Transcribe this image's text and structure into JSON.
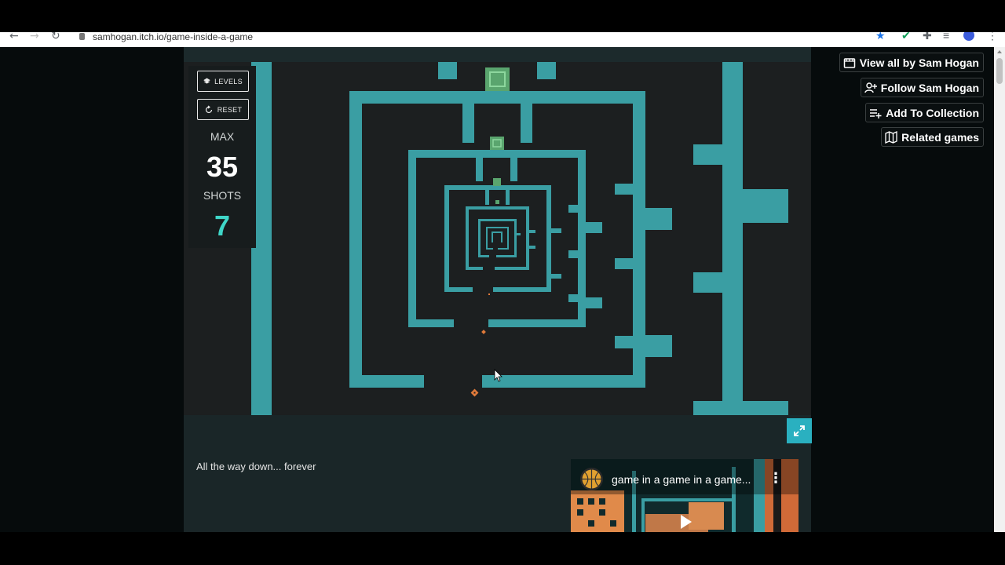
{
  "browser": {
    "url": "samhogan.itch.io/game-inside-a-game"
  },
  "hud": {
    "levels_label": "LEVELS",
    "reset_label": "RESET",
    "max_label": "MAX",
    "max_value": "35",
    "shots_label": "SHOTS",
    "shots_value": "7",
    "shots_color": "#3fd6c8"
  },
  "sidebar": {
    "view_all": "View all by Sam Hogan",
    "follow": "Follow Sam Hogan",
    "add_collection": "Add To Collection",
    "related": "Related games"
  },
  "page": {
    "description": "All the way down... forever"
  },
  "video": {
    "title": "game in a game in a game..."
  },
  "colors": {
    "wall": "#3a9ea3",
    "goal": "#5aa56e",
    "accent": "#2ab0c0",
    "player": "#e07a3a"
  }
}
